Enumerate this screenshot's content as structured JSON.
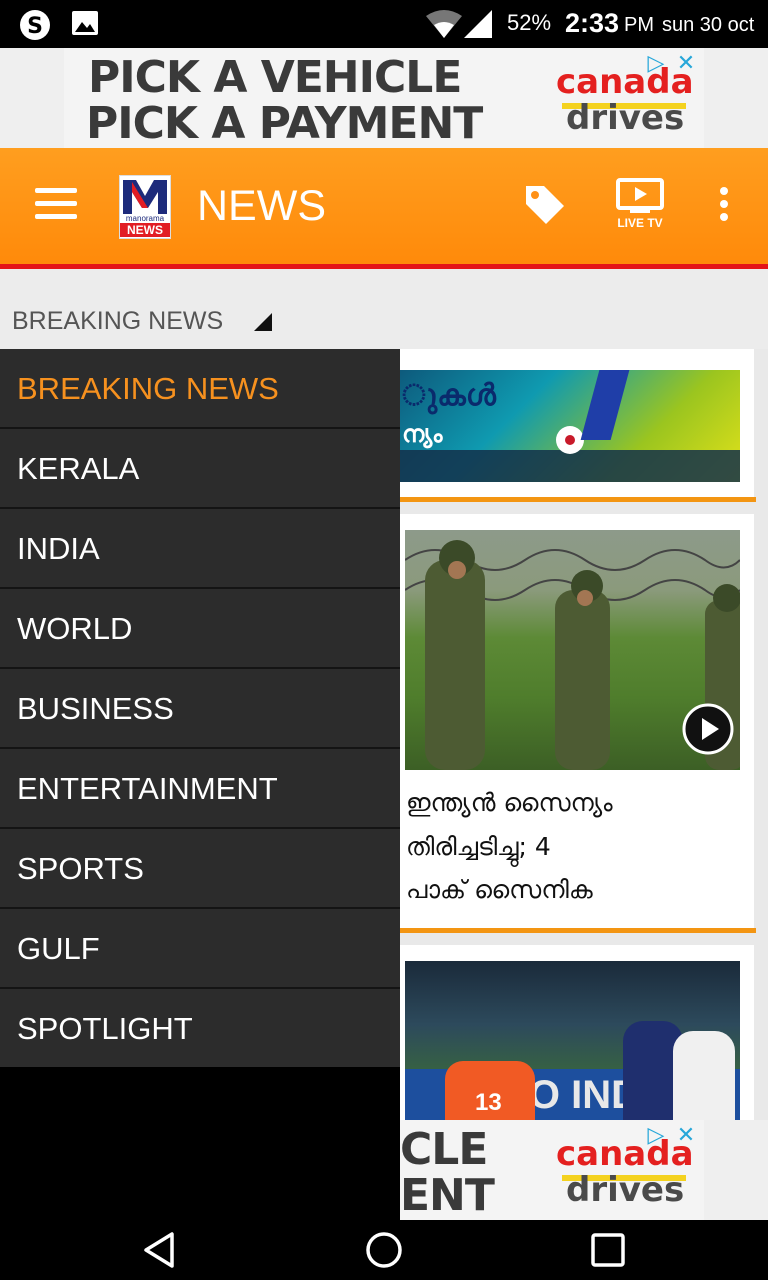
{
  "status_bar": {
    "battery": "52%",
    "time": "2:33",
    "ampm": "PM",
    "date": "sun 30 oct",
    "icons": [
      "skype-icon",
      "gallery-icon",
      "wifi-icon",
      "signal-icon",
      "battery-icon"
    ]
  },
  "ad_top": {
    "line1": "PICK A VEHICLE",
    "line2": "PICK A PAYMENT",
    "brand_line1": "canada",
    "brand_line2": "drives"
  },
  "ad_bottom": {
    "line1": "CLE",
    "line2": "ENT",
    "brand_line1": "canada",
    "brand_line2": "drives"
  },
  "header": {
    "logo_top": "manorama",
    "logo_bottom": "NEWS",
    "title": "NEWS",
    "live_tv_label": "LIVE TV"
  },
  "category": {
    "selected": "BREAKING NEWS"
  },
  "drawer": {
    "items": [
      {
        "label": "BREAKING NEWS",
        "active": true
      },
      {
        "label": "KERALA"
      },
      {
        "label": "INDIA"
      },
      {
        "label": "WORLD"
      },
      {
        "label": "BUSINESS"
      },
      {
        "label": "ENTERTAINMENT"
      },
      {
        "label": "SPORTS"
      },
      {
        "label": "GULF"
      },
      {
        "label": "SPOTLIGHT"
      }
    ]
  },
  "cards": [
    {
      "image_text_line1": "ുകൾ",
      "image_text_line2": "ന്യം"
    },
    {
      "headline_line1": "ഇന്ത്യൻ സൈന്യം",
      "headline_line2": "തിരിച്ചടിച്ചു; 4",
      "headline_line3": "പാക് സൈനിക"
    },
    {
      "jersey_number": "13",
      "banner_text": "RO INDIAN"
    }
  ],
  "colors": {
    "accent_orange": "#ff9117",
    "header_red_line": "#e41418",
    "drawer_bg": "#2c2c2c",
    "active_item": "#f6911f"
  }
}
